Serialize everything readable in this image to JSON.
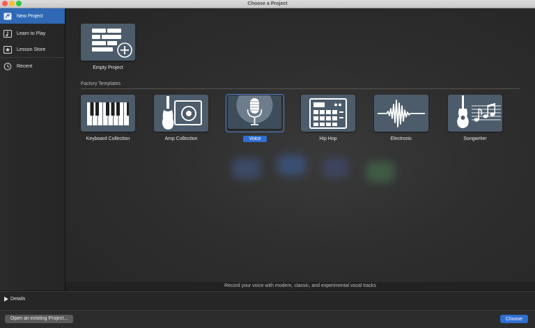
{
  "window": {
    "title": "Choose a Project"
  },
  "sidebar": {
    "items": [
      {
        "label": "New Project",
        "icon": "new-project-icon",
        "active": true
      },
      {
        "label": "Learn to Play",
        "icon": "learn-to-play-icon",
        "active": false
      },
      {
        "label": "Lesson Store",
        "icon": "lesson-store-icon",
        "active": false
      },
      {
        "label": "Recent",
        "icon": "clock-icon",
        "active": false
      }
    ]
  },
  "main": {
    "empty_project": {
      "label": "Empty Project",
      "icon": "empty-project-grid-plus-icon"
    },
    "section_title": "Factory Templates",
    "templates": [
      {
        "label": "Keyboard Collection",
        "icon": "piano-keys-icon",
        "selected": false
      },
      {
        "label": "Amp Collection",
        "icon": "guitar-amp-icon",
        "selected": false
      },
      {
        "label": "Voice",
        "icon": "microphone-icon",
        "selected": true
      },
      {
        "label": "Hip Hop",
        "icon": "drum-machine-icon",
        "selected": false
      },
      {
        "label": "Electronic",
        "icon": "waveform-icon",
        "selected": false
      },
      {
        "label": "Songwriter",
        "icon": "acoustic-guitar-notes-icon",
        "selected": false
      }
    ],
    "description": "Record your voice with modern, classic, and experimental vocal tracks"
  },
  "details": {
    "label": "Details",
    "icon": "disclosure-triangle-icon"
  },
  "buttons": {
    "open_existing": "Open an existing Project...",
    "choose": "Choose"
  },
  "colors": {
    "accent": "#2f6fd1",
    "sidebar_selected": "#2f68b5",
    "tile": "#4c5c6b"
  }
}
